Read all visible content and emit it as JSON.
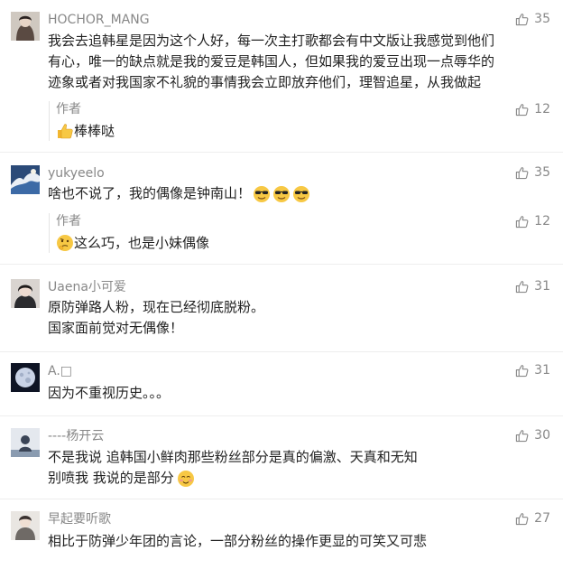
{
  "comments": [
    {
      "username": "HOCHOR_MANG",
      "lines": [
        "我会去追韩星是因为这个人好，每一次主打歌都会有中文版让我感觉到他们",
        "有心，唯一的缺点就是我的爱豆是韩国人，但如果我的爱豆出现一点辱华的",
        "迹象或者对我国家不礼貌的事情我会立即放弃他们，理智追星，从我做起"
      ],
      "likes": "35",
      "reply": {
        "author": "作者",
        "text": "棒棒哒",
        "likes": "12"
      }
    },
    {
      "username": "yukyeelo",
      "lines": [
        "啥也不说了，我的偶像是钟南山！"
      ],
      "likes": "35",
      "reply": {
        "author": "作者",
        "text": "这么巧，也是小妹偶像",
        "likes": "12"
      }
    },
    {
      "username": "Uaena小可爱",
      "lines": [
        "原防弹路人粉，现在已经彻底脱粉。",
        "国家面前觉对无偶像！"
      ],
      "likes": "31"
    },
    {
      "username": "A.□",
      "lines": [
        "因为不重视历史。。。"
      ],
      "likes": "31"
    },
    {
      "username": "----杨开云",
      "lines": [
        "不是我说 追韩国小鲜肉那些粉丝部分是真的偏激、天真和无知",
        "别喷我 我说的是部分"
      ],
      "likes": "30"
    },
    {
      "username": "早起要听歌",
      "lines": [
        "相比于防弹少年团的言论，一部分粉丝的操作更显的可笑又可悲"
      ],
      "likes": "27"
    }
  ]
}
